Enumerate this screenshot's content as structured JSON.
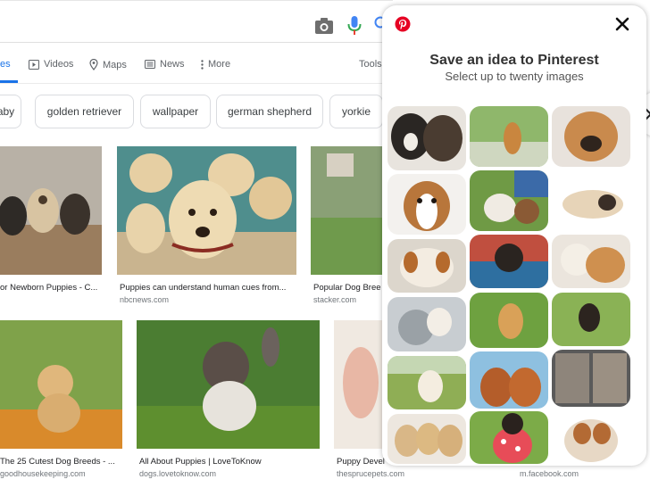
{
  "tabs": [
    {
      "label": "es",
      "icon": "none"
    },
    {
      "label": "Videos",
      "icon": "video-icon"
    },
    {
      "label": "Maps",
      "icon": "map-pin-icon"
    },
    {
      "label": "News",
      "icon": "news-icon"
    },
    {
      "label": "More",
      "icon": "more-vert-icon"
    }
  ],
  "tools_label": "Tools",
  "chips": [
    "aby",
    "golden retriever",
    "wallpaper",
    "german shepherd",
    "yorkie"
  ],
  "results": [
    {
      "caption": "or Newborn Puppies - C...",
      "source": ""
    },
    {
      "caption": "Puppies can understand human cues from...",
      "source": "nbcnews.com"
    },
    {
      "caption": "Popular Dog Bree",
      "source": "stacker.com"
    },
    {
      "caption": "The 25 Cutest Dog Breeds - ...",
      "source": "goodhousekeeping.com"
    },
    {
      "caption": "All About Puppies | LoveToKnow",
      "source": "dogs.lovetoknow.com"
    },
    {
      "caption": "Puppy Devel",
      "source": "thesprucepets.com"
    },
    {
      "caption": "",
      "source": "m.facebook.com"
    }
  ],
  "pinterest": {
    "title": "Save an idea to Pinterest",
    "subtitle": "Select up to twenty images",
    "brand_color": "#e60023"
  },
  "colors": {
    "accent": "#1a73e8",
    "mic_blue": "#4285f4",
    "mic_red": "#ea4335"
  }
}
